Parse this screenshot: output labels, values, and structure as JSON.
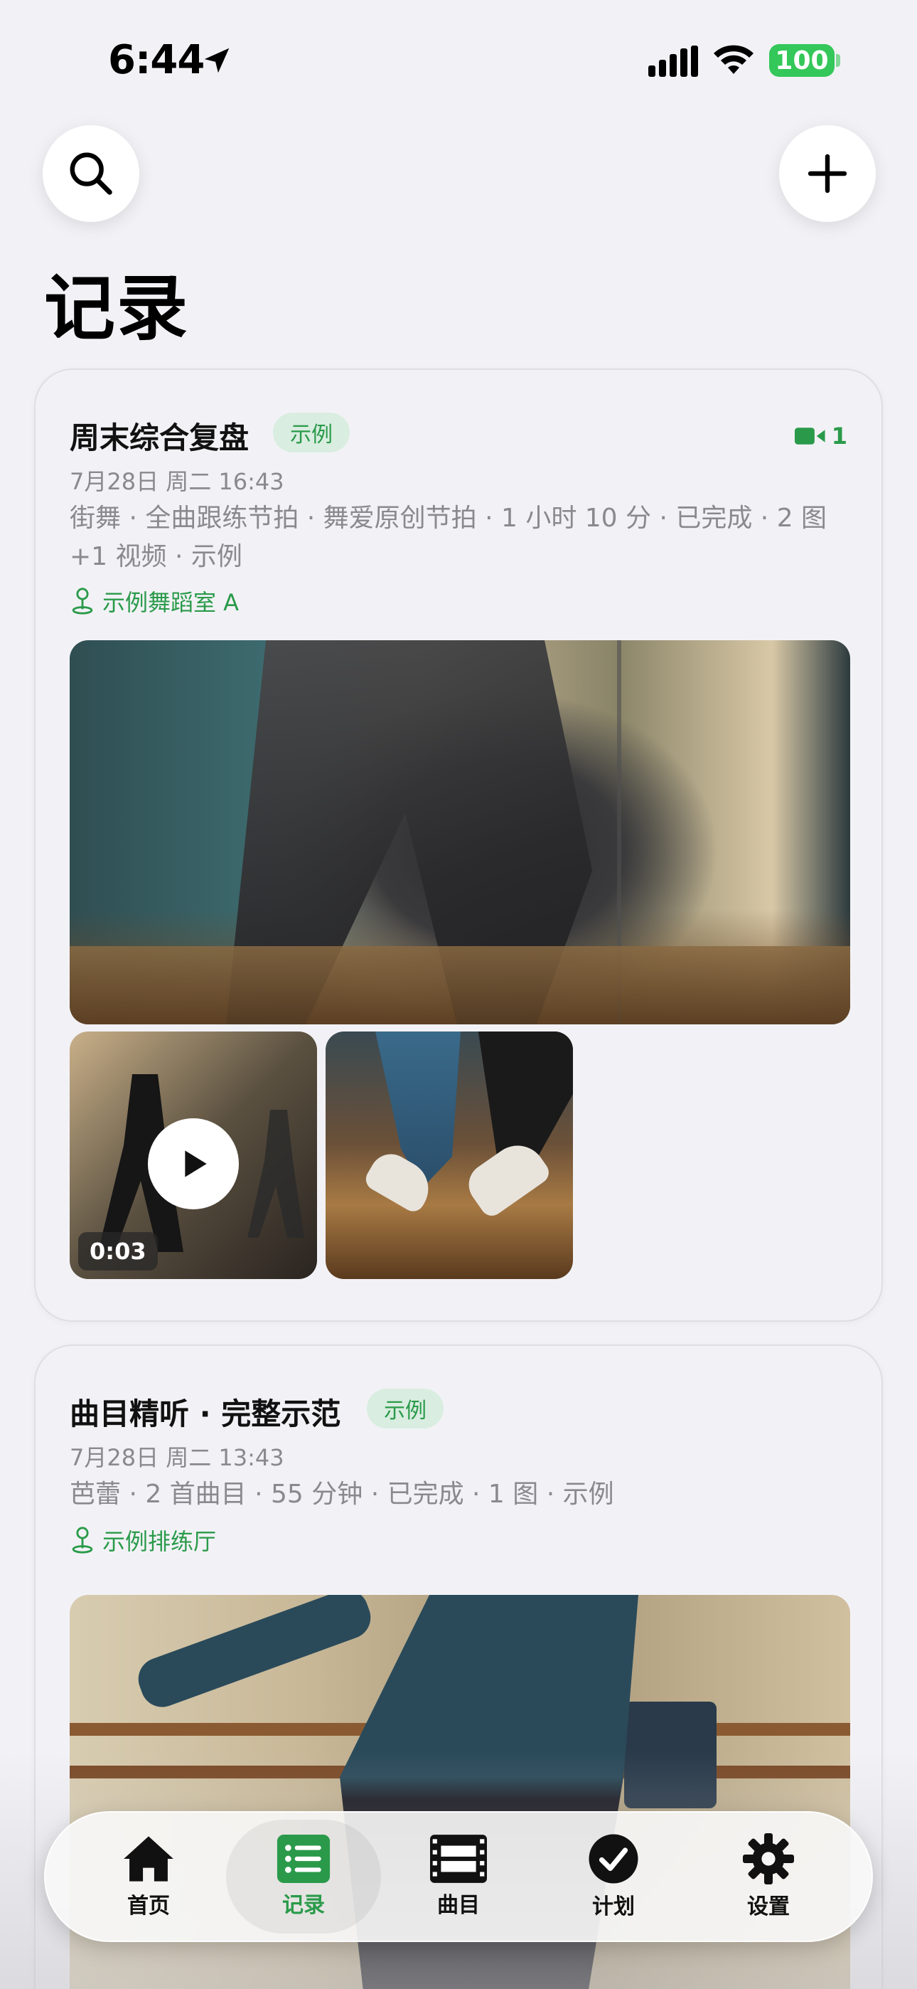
{
  "status_bar": {
    "time": "6:44",
    "battery": "100"
  },
  "header": {
    "title": "记录"
  },
  "records": [
    {
      "title": "周末综合复盘",
      "tag": "示例",
      "video_count": "1",
      "date": "7月28日 周二 16:43",
      "summary": "街舞 · 全曲跟练节拍 · 舞爱原创节拍 · 1 小时 10 分 · 已完成 · 2 图 +1 视频 · 示例",
      "location": "示例舞蹈室 A",
      "video_duration": "0:03"
    },
    {
      "title": "曲目精听 · 完整示范",
      "tag": "示例",
      "date": "7月28日 周二 13:43",
      "summary": "芭蕾 · 2 首曲目 · 55 分钟 · 已完成 · 1 图 · 示例",
      "location": "示例排练厅"
    }
  ],
  "tabbar": {
    "items": [
      {
        "label": "首页",
        "icon": "house-icon"
      },
      {
        "label": "记录",
        "icon": "list-icon",
        "active": true
      },
      {
        "label": "曲目",
        "icon": "film-icon"
      },
      {
        "label": "计划",
        "icon": "checkmark-circle-icon"
      },
      {
        "label": "设置",
        "icon": "gear-icon"
      }
    ]
  },
  "colors": {
    "accent": "#2a9a4a",
    "tag_bg": "#d9ede0",
    "background": "#f2f2f6"
  }
}
